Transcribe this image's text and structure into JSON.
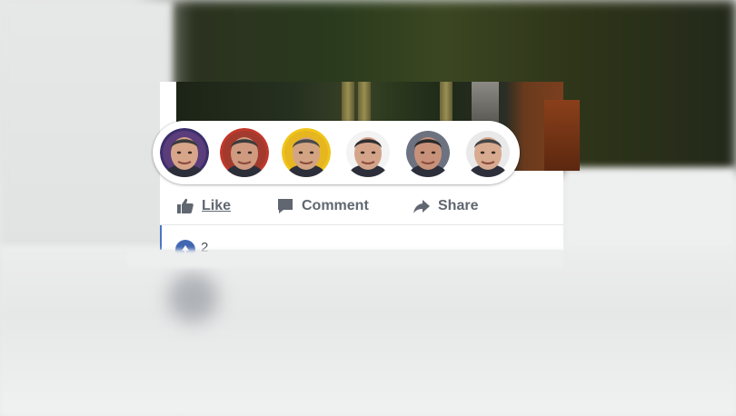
{
  "reactions": {
    "faces": [
      {
        "name": "reaction-face-1",
        "skin": "#d7a58a",
        "hair": "#3a3a3a",
        "ring": "#3b2f6b",
        "bg": "#5a3d7a"
      },
      {
        "name": "reaction-face-2",
        "skin": "#cf9a80",
        "hair": "#3b3b3b",
        "ring": "#c0392b",
        "bg": "#a33a2e"
      },
      {
        "name": "reaction-face-3",
        "skin": "#d3a483",
        "hair": "#4a4a4a",
        "ring": "#f0c419",
        "bg": "#e6b620"
      },
      {
        "name": "reaction-face-4",
        "skin": "#d4a48a",
        "hair": "#2f2f2f",
        "ring": "#ffffff",
        "bg": "#f3f3f3"
      },
      {
        "name": "reaction-face-5",
        "skin": "#c8927a",
        "hair": "#2a2a2a",
        "ring": "#ffffff",
        "bg": "#6d7280"
      },
      {
        "name": "reaction-face-6",
        "skin": "#d8aa90",
        "hair": "#444444",
        "ring": "#ffffff",
        "bg": "#e9e9e9"
      }
    ]
  },
  "actions": {
    "like_label": "Like",
    "like_icon": "thumbs-up-icon",
    "comment_label": "Comment",
    "comment_icon": "speech-bubble-icon",
    "share_label": "Share",
    "share_icon": "share-arrow-icon"
  },
  "comments": {
    "icon": "comment-badge-icon",
    "count": "2"
  },
  "colors": {
    "action_text": "#606770",
    "accent": "#4267b2"
  }
}
